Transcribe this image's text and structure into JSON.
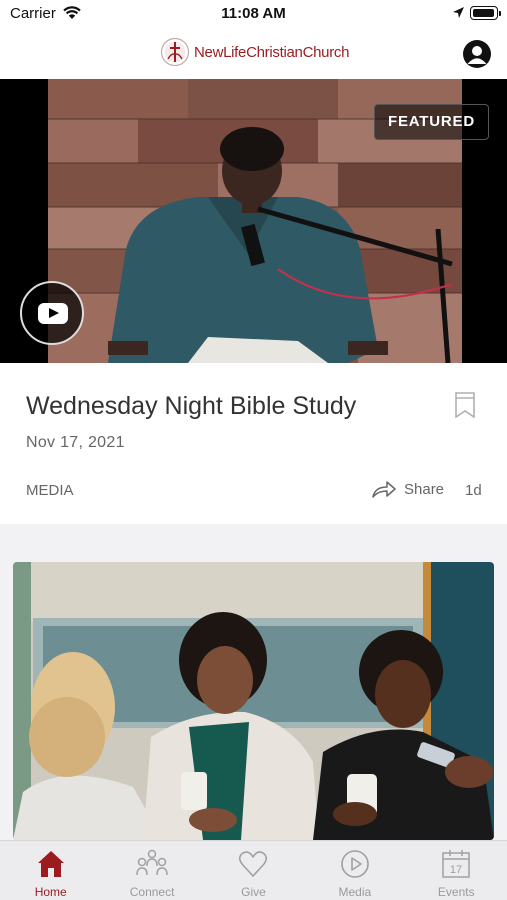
{
  "status_bar": {
    "carrier": "Carrier",
    "time": "11:08 AM"
  },
  "header": {
    "logo_text": "NewLifeChristianChurch",
    "brand_color": "#9b1b1f"
  },
  "featured_post": {
    "badge": "FEATURED",
    "title": "Wednesday Night Bible Study",
    "date": "Nov 17, 2021",
    "category": "MEDIA",
    "share_label": "Share",
    "age": "1d"
  },
  "tabs": [
    {
      "label": "Home",
      "icon": "home-icon",
      "active": true
    },
    {
      "label": "Connect",
      "icon": "people-icon",
      "active": false
    },
    {
      "label": "Give",
      "icon": "heart-icon",
      "active": false
    },
    {
      "label": "Media",
      "icon": "play-circle-icon",
      "active": false
    },
    {
      "label": "Events",
      "icon": "calendar-icon",
      "active": false
    }
  ],
  "calendar_day": "17"
}
